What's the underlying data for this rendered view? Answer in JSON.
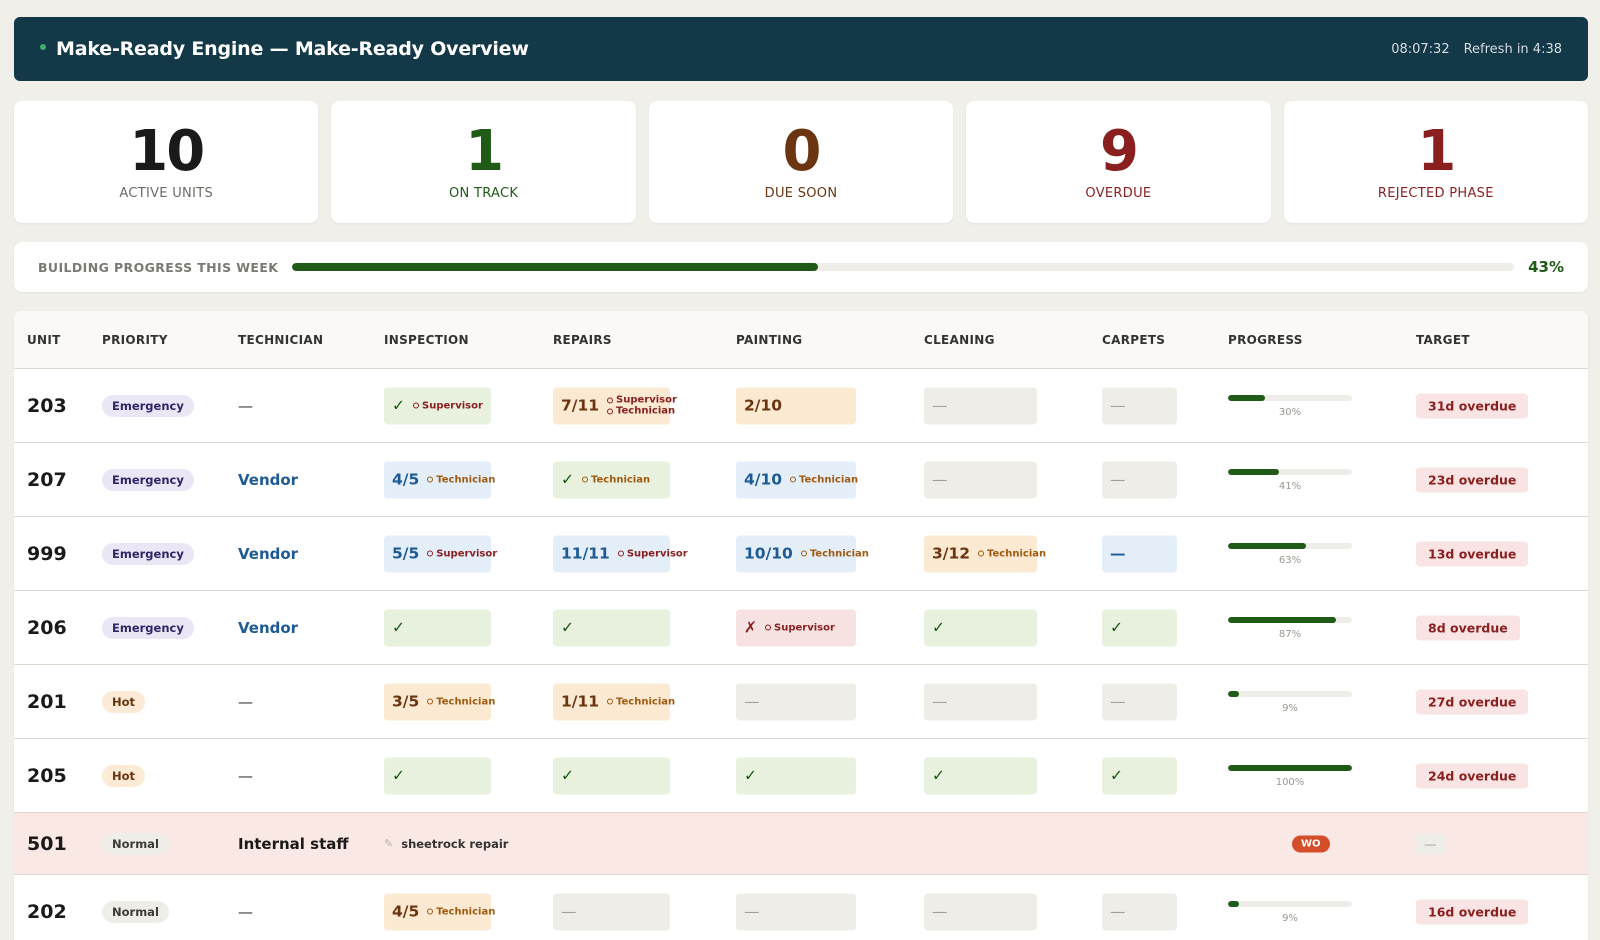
{
  "header": {
    "title": "Make-Ready Engine — Make-Ready Overview",
    "clock": "08:07:32",
    "refresh": "Refresh in 4:38"
  },
  "stats": [
    {
      "value": "10",
      "label": "ACTIVE UNITS",
      "color": "#1a1a1a"
    },
    {
      "value": "1",
      "label": "ON TRACK",
      "color": "#1f5a17"
    },
    {
      "value": "0",
      "label": "DUE SOON",
      "color": "#6a3510"
    },
    {
      "value": "9",
      "label": "OVERDUE",
      "color": "#8a1f1f"
    },
    {
      "value": "1",
      "label": "REJECTED PHASE",
      "color": "#8a1f1f"
    }
  ],
  "building_progress": {
    "label": "BUILDING PROGRESS THIS WEEK",
    "percent": 43,
    "text": "43%"
  },
  "columns": [
    "UNIT",
    "PRIORITY",
    "TECHNICIAN",
    "INSPECTION",
    "REPAIRS",
    "PAINTING",
    "CLEANING",
    "CARPETS",
    "PROGRESS",
    "TARGET"
  ],
  "rows": [
    {
      "unit": "203",
      "priority": "Emergency",
      "priority_class": "emergency",
      "technician": "—",
      "tech_class": "dash",
      "phases": [
        {
          "state": "done",
          "text": "✓",
          "assignees": [
            {
              "role": "sup",
              "name": "Supervisor"
            }
          ]
        },
        {
          "state": "warm",
          "text": "7/11",
          "assignees": [
            {
              "role": "sup",
              "name": "Supervisor"
            },
            {
              "role": "sup",
              "name": "Technician"
            }
          ]
        },
        {
          "state": "warm",
          "text": "2/10",
          "assignees": []
        },
        {
          "state": "none",
          "text": "—",
          "assignees": []
        },
        {
          "state": "none",
          "text": "—",
          "assignees": []
        }
      ],
      "progress": 30,
      "progress_text": "30%",
      "target": "31d overdue"
    },
    {
      "unit": "207",
      "priority": "Emergency",
      "priority_class": "emergency",
      "technician": "Vendor",
      "tech_class": "vendor",
      "phases": [
        {
          "state": "blue",
          "text": "4/5",
          "assignees": [
            {
              "role": "tec",
              "name": "Technician"
            }
          ]
        },
        {
          "state": "done",
          "text": "✓",
          "assignees": [
            {
              "role": "tec",
              "name": "Technician"
            }
          ]
        },
        {
          "state": "blue",
          "text": "4/10",
          "assignees": [
            {
              "role": "tec",
              "name": "Technician"
            }
          ]
        },
        {
          "state": "none",
          "text": "—",
          "assignees": []
        },
        {
          "state": "none",
          "text": "—",
          "assignees": []
        }
      ],
      "progress": 41,
      "progress_text": "41%",
      "target": "23d overdue"
    },
    {
      "unit": "999",
      "priority": "Emergency",
      "priority_class": "emergency",
      "technician": "Vendor",
      "tech_class": "vendor",
      "phases": [
        {
          "state": "blue",
          "text": "5/5",
          "assignees": [
            {
              "role": "sup",
              "name": "Supervisor"
            }
          ]
        },
        {
          "state": "blue",
          "text": "11/11",
          "assignees": [
            {
              "role": "sup",
              "name": "Supervisor"
            }
          ]
        },
        {
          "state": "blue",
          "text": "10/10",
          "assignees": [
            {
              "role": "tec",
              "name": "Technician"
            }
          ]
        },
        {
          "state": "warm",
          "text": "3/12",
          "assignees": [
            {
              "role": "tec",
              "name": "Technician"
            }
          ]
        },
        {
          "state": "blue",
          "text": "—",
          "assignees": []
        }
      ],
      "progress": 63,
      "progress_text": "63%",
      "target": "13d overdue"
    },
    {
      "unit": "206",
      "priority": "Emergency",
      "priority_class": "emergency",
      "technician": "Vendor",
      "tech_class": "vendor",
      "phases": [
        {
          "state": "done",
          "text": "✓",
          "assignees": []
        },
        {
          "state": "done",
          "text": "✓",
          "assignees": []
        },
        {
          "state": "rej",
          "text": "✗",
          "assignees": [
            {
              "role": "sup",
              "name": "Supervisor"
            }
          ]
        },
        {
          "state": "done",
          "text": "✓",
          "assignees": []
        },
        {
          "state": "done",
          "text": "✓",
          "assignees": []
        }
      ],
      "progress": 87,
      "progress_text": "87%",
      "target": "8d overdue"
    },
    {
      "unit": "201",
      "priority": "Hot",
      "priority_class": "hot",
      "technician": "—",
      "tech_class": "dash",
      "phases": [
        {
          "state": "warm",
          "text": "3/5",
          "assignees": [
            {
              "role": "tec",
              "name": "Technician"
            }
          ]
        },
        {
          "state": "warm",
          "text": "1/11",
          "assignees": [
            {
              "role": "tec",
              "name": "Technician"
            }
          ]
        },
        {
          "state": "none",
          "text": "—",
          "assignees": []
        },
        {
          "state": "none",
          "text": "—",
          "assignees": []
        },
        {
          "state": "none",
          "text": "—",
          "assignees": []
        }
      ],
      "progress": 9,
      "progress_text": "9%",
      "target": "27d overdue"
    },
    {
      "unit": "205",
      "priority": "Hot",
      "priority_class": "hot",
      "technician": "—",
      "tech_class": "dash",
      "phases": [
        {
          "state": "done",
          "text": "✓",
          "assignees": []
        },
        {
          "state": "done",
          "text": "✓",
          "assignees": []
        },
        {
          "state": "done",
          "text": "✓",
          "assignees": []
        },
        {
          "state": "done",
          "text": "✓",
          "assignees": []
        },
        {
          "state": "done",
          "text": "✓",
          "assignees": []
        }
      ],
      "progress": 100,
      "progress_text": "100%",
      "target": "24d overdue"
    },
    {
      "unit": "501",
      "priority": "Normal",
      "priority_class": "normal",
      "technician": "Internal staff",
      "tech_class": "internal",
      "flagged": true,
      "note": "sheetrock repair",
      "badge": "WO",
      "target": "—"
    },
    {
      "unit": "202",
      "priority": "Normal",
      "priority_class": "normal",
      "technician": "—",
      "tech_class": "dash",
      "phases": [
        {
          "state": "warm",
          "text": "4/5",
          "assignees": [
            {
              "role": "tec",
              "name": "Technician"
            }
          ]
        },
        {
          "state": "none",
          "text": "—",
          "assignees": []
        },
        {
          "state": "none",
          "text": "—",
          "assignees": []
        },
        {
          "state": "none",
          "text": "—",
          "assignees": []
        },
        {
          "state": "none",
          "text": "—",
          "assignees": []
        }
      ],
      "progress": 9,
      "progress_text": "9%",
      "target": "16d overdue"
    }
  ]
}
